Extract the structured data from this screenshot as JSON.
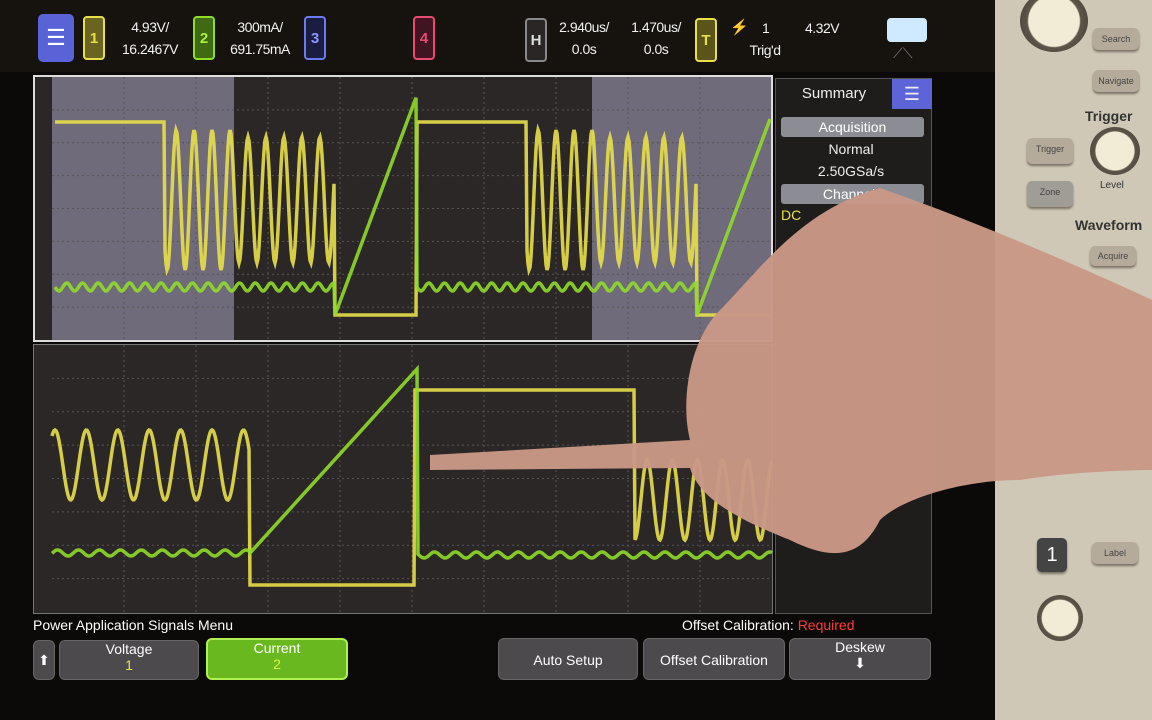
{
  "topbar": {
    "ch1": {
      "label": "1",
      "scale": "4.93V/",
      "offset": "16.2467V",
      "color": "#e8e04a"
    },
    "ch2": {
      "label": "2",
      "scale": "300mA/",
      "offset": "691.75mA",
      "color": "#8fdc2a"
    },
    "ch3": {
      "label": "3",
      "color": "#5a6ae8"
    },
    "ch4": {
      "label": "4",
      "color": "#e84a70"
    },
    "horizontal": {
      "label": "H",
      "scale": "2.940us/",
      "position": "0.0s"
    },
    "zoom": {
      "scale": "1.470us/",
      "position": "0.0s"
    },
    "trigger": {
      "label": "T",
      "source": "1",
      "level": "4.32V",
      "status": "Trig'd"
    }
  },
  "summary": {
    "title": "Summary",
    "acquisition_label": "Acquisition",
    "mode": "Normal",
    "sample_rate": "2.50GSa/s",
    "channels_label": "Channels",
    "coupling": "DC"
  },
  "softkeys": {
    "menu_title": "Power Application Signals Menu",
    "offset_cal_label": "Offset Calibration:",
    "offset_cal_status": "Required",
    "voltage": {
      "label": "Voltage",
      "value": "1"
    },
    "current": {
      "label": "Current",
      "value": "2"
    },
    "auto_setup": "Auto Setup",
    "offset_calibration": "Offset Calibration",
    "deskew": "Deskew"
  },
  "front_panel": {
    "search": "Search",
    "navigate": "Navigate",
    "trigger_section": "Trigger",
    "trigger_btn": "Trigger",
    "level": "Level",
    "zone": "Zone",
    "waveform_section": "Waveform",
    "acquire": "Acquire",
    "label": "Label",
    "ch1": "1"
  },
  "colors": {
    "ch1": "#e8e04a",
    "ch2": "#8fdc2a",
    "required": "#ff3a3a"
  }
}
